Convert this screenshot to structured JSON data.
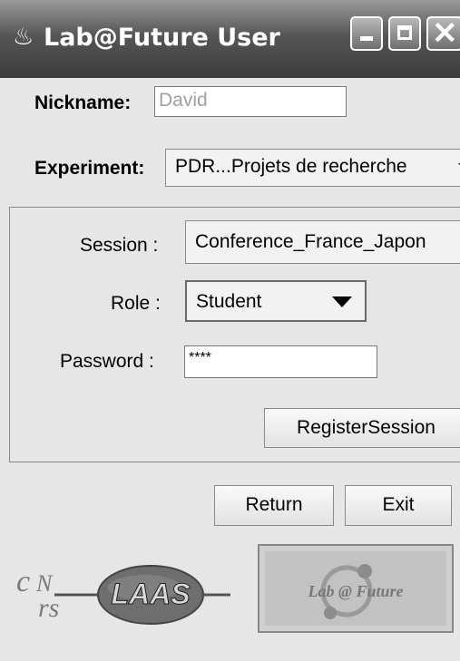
{
  "window": {
    "title": "Lab@Future User",
    "app_icon": "java-cup-icon"
  },
  "form": {
    "nickname_label": "Nickname:",
    "nickname_value": "David",
    "experiment_label": "Experiment:",
    "experiment_selected": "PDR...Projets de recherche"
  },
  "session_panel": {
    "session_label": "Session :",
    "session_selected": "Conference_France_Japon",
    "role_label": "Role :",
    "role_selected": "Student",
    "password_label": "Password :",
    "password_value": "****",
    "register_button": "RegisterSession"
  },
  "buttons": {
    "return": "Return",
    "exit": "Exit"
  },
  "logos": {
    "cnrs": "CNRS",
    "laas": "LAAS",
    "labfuture": "Lab@Future"
  },
  "colors": {
    "titlebar": "#4a4a4a",
    "background": "#e6e6e6"
  }
}
